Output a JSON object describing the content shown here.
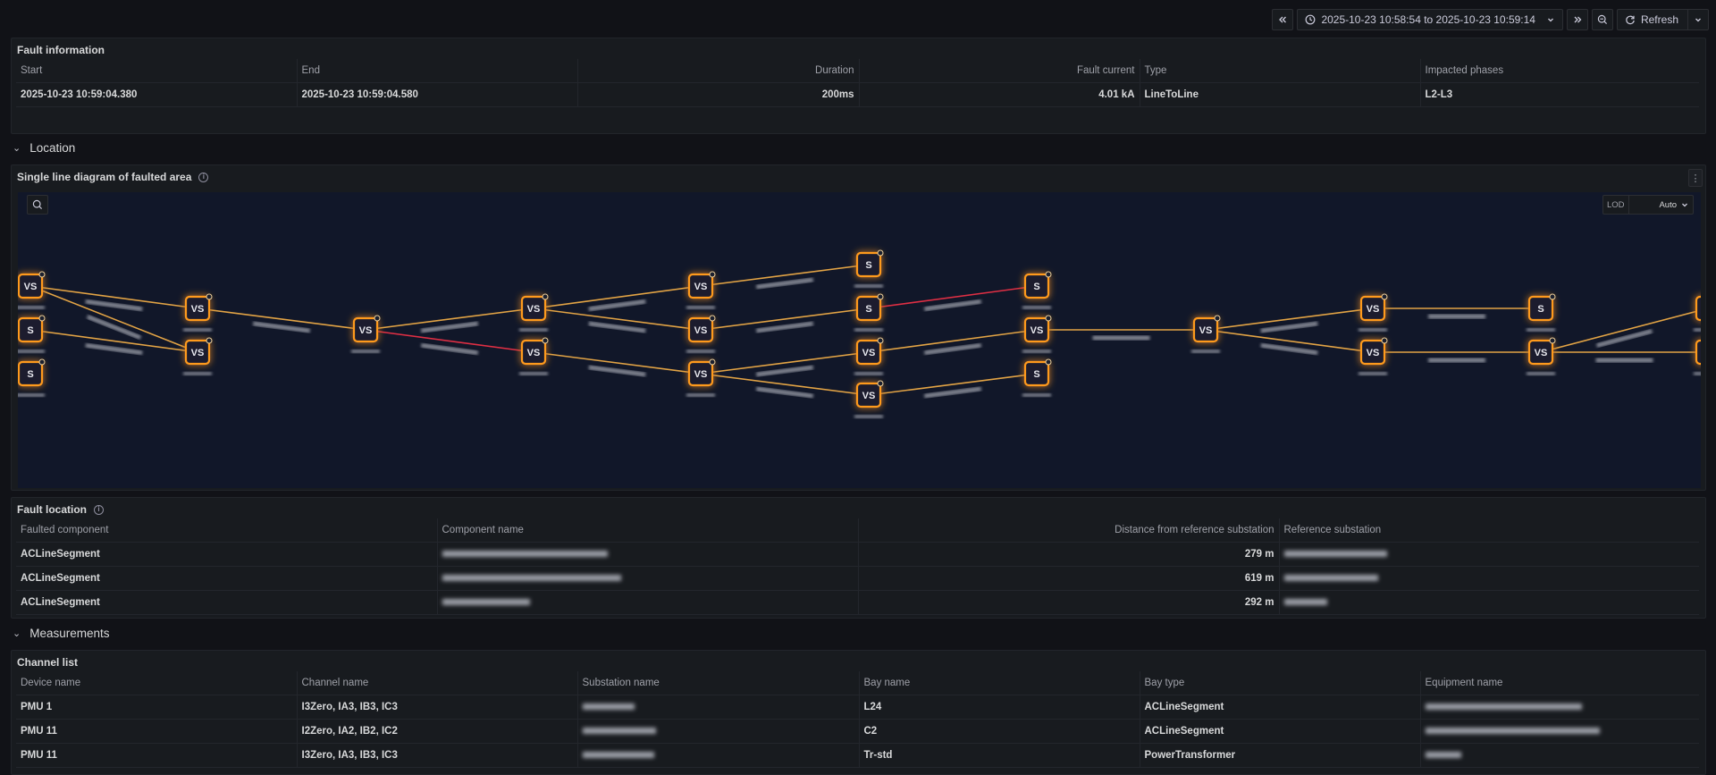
{
  "toolbar": {
    "time_range": "2025-10-23 10:58:54 to 2025-10-23 10:59:14",
    "refresh_label": "Refresh"
  },
  "fault_info": {
    "title": "Fault information",
    "columns": [
      "Start",
      "End",
      "Duration",
      "Fault current",
      "Type",
      "Impacted phases"
    ],
    "row": [
      "2025-10-23 10:59:04.380",
      "2025-10-23 10:59:04.580",
      "200ms",
      "4.01 kA",
      "LineToLine",
      "L2-L3"
    ]
  },
  "location": {
    "section_label": "Location",
    "diagram_title": "Single line diagram of faulted area",
    "lod_label": "LOD",
    "lod_value": "Auto",
    "node_colors": {
      "fill": "#1a1f2e",
      "glow": "#ff9a1f",
      "line": "#e3a445",
      "fault_line": "#e02f44"
    },
    "nodes": [
      {
        "id": "n1",
        "label": "VS"
      },
      {
        "id": "n2",
        "label": "S"
      },
      {
        "id": "n3",
        "label": "S"
      },
      {
        "id": "n4",
        "label": "VS"
      },
      {
        "id": "n5",
        "label": "VS"
      },
      {
        "id": "n6",
        "label": "VS"
      },
      {
        "id": "n7",
        "label": "VS"
      },
      {
        "id": "n8",
        "label": "VS"
      },
      {
        "id": "n9",
        "label": "VS"
      },
      {
        "id": "n10",
        "label": "VS"
      },
      {
        "id": "n11",
        "label": "VS"
      },
      {
        "id": "n12",
        "label": "S"
      },
      {
        "id": "n13",
        "label": "S"
      },
      {
        "id": "n14",
        "label": "VS"
      },
      {
        "id": "n15",
        "label": "VS"
      },
      {
        "id": "n16",
        "label": "S"
      },
      {
        "id": "n17",
        "label": "VS"
      },
      {
        "id": "n18",
        "label": "S"
      },
      {
        "id": "n19",
        "label": "VS"
      },
      {
        "id": "n20",
        "label": "VS"
      },
      {
        "id": "n21",
        "label": "VS"
      },
      {
        "id": "n22",
        "label": "S"
      },
      {
        "id": "n23",
        "label": "VS"
      },
      {
        "id": "n24",
        "label": "VS"
      },
      {
        "id": "n25",
        "label": "VS"
      }
    ]
  },
  "fault_location": {
    "title": "Fault location",
    "columns": [
      "Faulted component",
      "Component name",
      "Distance from reference substation",
      "Reference substation"
    ],
    "rows": [
      {
        "component": "ACLineSegment",
        "distance": "279 m"
      },
      {
        "component": "ACLineSegment",
        "distance": "619 m"
      },
      {
        "component": "ACLineSegment",
        "distance": "292 m"
      }
    ]
  },
  "measurements": {
    "section_label": "Measurements",
    "channel_list_title": "Channel list",
    "columns": [
      "Device name",
      "Channel name",
      "Substation name",
      "Bay name",
      "Bay type",
      "Equipment name"
    ],
    "rows": [
      {
        "device": "PMU 1",
        "channel": "I3Zero, IA3, IB3, IC3",
        "bay": "L24",
        "bay_type": "ACLineSegment"
      },
      {
        "device": "PMU 11",
        "channel": "I2Zero, IA2, IB2, IC2",
        "bay": "C2",
        "bay_type": "ACLineSegment"
      },
      {
        "device": "PMU 11",
        "channel": "I3Zero, IA3, IB3, IC3",
        "bay": "Tr-std",
        "bay_type": "PowerTransformer"
      }
    ]
  }
}
